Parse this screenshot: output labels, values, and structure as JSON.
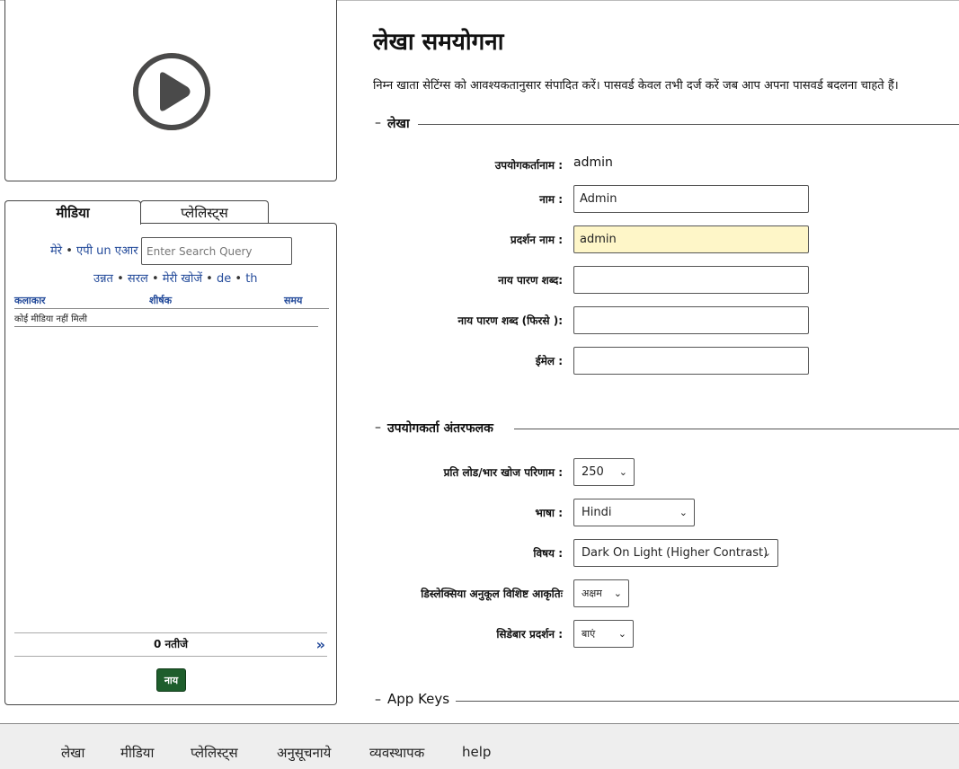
{
  "sidebar": {
    "tabs": [
      "मीडिया",
      "प्लेलिस्ट्स"
    ],
    "filters": {
      "mine": "मेरे",
      "sep1": "•",
      "api": "एपी un एआर"
    },
    "search_placeholder": "Enter Search Query",
    "links": [
      "उन्नत",
      "सरल",
      "मेरी खोजें",
      "de",
      "th"
    ],
    "separator": "•",
    "table": {
      "columns": [
        "कलाकार",
        "शीर्षक",
        "समय"
      ],
      "empty_text": "कोई मीडिया नहीं मिली"
    },
    "results_text": "0 नतीजे",
    "next_glyph": "»",
    "new_button": "नाय"
  },
  "main": {
    "title": "लेखा समयोगना",
    "intro": "निम्न खाता सेटिंग्स को आवश्यकतानुसार संपादित करें। पासवर्ड केवल तभी दर्ज करें जब आप अपना पासवर्ड बदलना चाहते हैं।",
    "sections": {
      "account": "लेखा",
      "interface": "उपयोगकर्ता अंतरफलक",
      "app_keys": "App Keys"
    },
    "dash": "–",
    "account": {
      "username_label": "उपयोगकर्तानाम :",
      "username_value": "admin",
      "name_label": "नाम :",
      "name_value": "Admin",
      "display_label": "प्रदर्शन नाम :",
      "display_value": "admin",
      "password_label": "नाय पारण शब्द:",
      "password_value": "",
      "password2_label": "नाय पारण शब्द (फिरसे ):",
      "password2_value": "",
      "email_label": "ईमेल :",
      "email_value": ""
    },
    "interface": {
      "per_page_label": "प्रति लोड/भार खोज परिणाम :",
      "per_page_value": "250",
      "language_label": "भाषा :",
      "language_value": "Hindi",
      "theme_label": "विषय :",
      "theme_value": "Dark On Light (Higher Contrast)",
      "dyslexia_label": "डिस्लेक्सिया अनुकूल विशिष्ट आकृतिः",
      "dyslexia_value": "अक्षम",
      "sidebar_label": "सिडेबार प्रदर्शन :",
      "sidebar_value": "बाएं"
    },
    "chevron": "⌄"
  },
  "bottom_nav": [
    "लेखा",
    "मीडिया",
    "प्लेलिस्ट्स",
    "अनुसूचनाये",
    "व्यवस्थापक",
    "help"
  ],
  "colors": {
    "link": "#234a9a",
    "new_button": "#1e5e2c",
    "highlight_field": "#fef6c8"
  }
}
